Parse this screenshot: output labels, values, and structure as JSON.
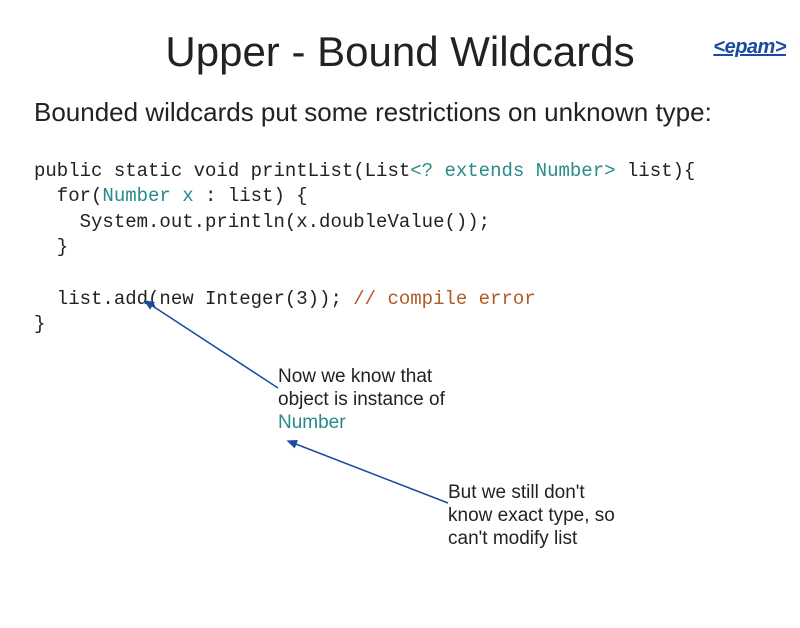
{
  "logo": "<epam>",
  "title": "Upper - Bound Wildcards",
  "subtitle": "Bounded wildcards put some restrictions on unknown type:",
  "code": {
    "l1a": "public static void printList(List",
    "l1b": "<? extends Number>",
    "l1c": " list){",
    "l2a": "  for(",
    "l2b": "Number x",
    "l2c": " : list) {",
    "l3": "    System.out.println(x.doubleValue());",
    "l4": "  }",
    "l5": "",
    "l6a": "  list.add(new Integer(3)); ",
    "l6b": "// compile error",
    "l7": "}"
  },
  "anno1_l1": "Now we know that",
  "anno1_l2": "object is instance of",
  "anno1_l3": "Number",
  "anno2_l1": "But we still don't",
  "anno2_l2": "know exact type, so",
  "anno2_l3": "can't modify list"
}
